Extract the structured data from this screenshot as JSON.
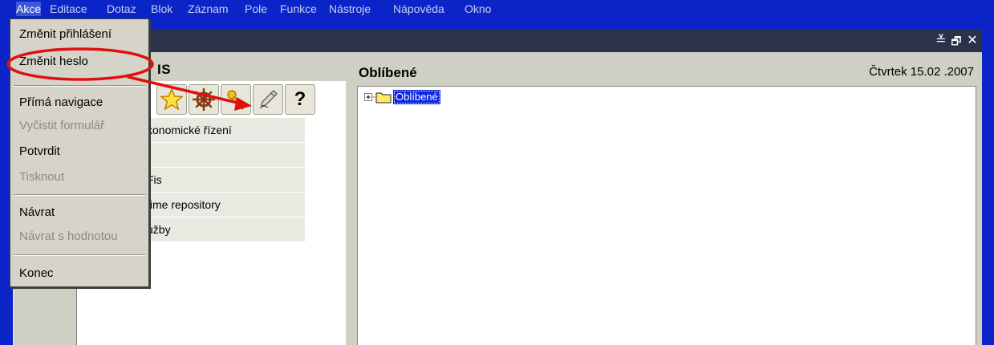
{
  "menubar": {
    "items": [
      {
        "label": "Akce",
        "active": true
      },
      {
        "label": "Editace"
      },
      {
        "label": "Dotaz"
      },
      {
        "label": "Blok"
      },
      {
        "label": "Záznam"
      },
      {
        "label": "Pole"
      },
      {
        "label": "Funkce"
      },
      {
        "label": "Nástroje"
      },
      {
        "label": "Nápověda"
      },
      {
        "label": "Okno"
      }
    ]
  },
  "window": {
    "buttons": {
      "minimize": "≚",
      "restore": "🗗",
      "close": "✕"
    }
  },
  "left_panel": {
    "title": "IS",
    "toolbar": [
      "star-icon",
      "helm-icon",
      "key-icon",
      "pen-icon",
      "help-icon"
    ],
    "help_label": "?",
    "modules": [
      "konomické řízení",
      "",
      "Fis",
      "time repository",
      "užby"
    ]
  },
  "right_panel": {
    "title": "Oblíbené",
    "date": "Čtvrtek 15.02 .2007",
    "tree": {
      "node_label": "Oblíbené"
    }
  },
  "dropdown": {
    "items": [
      {
        "label": "Změnit přihlášení",
        "enabled": true
      },
      {
        "label": "Změnit heslo",
        "enabled": true,
        "highlighted_annotation": true
      },
      {
        "label": "Přímá navigace",
        "enabled": true
      },
      {
        "label": "Vyčistit formulář",
        "enabled": false
      },
      {
        "label": "Potvrdit",
        "enabled": true
      },
      {
        "label": "Tisknout",
        "enabled": false
      },
      {
        "label": "Návrat",
        "enabled": true
      },
      {
        "label": "Návrat s hodnotou",
        "enabled": false
      },
      {
        "label": "Konec",
        "enabled": true
      }
    ]
  },
  "annotation": {
    "color": "#e01010"
  }
}
